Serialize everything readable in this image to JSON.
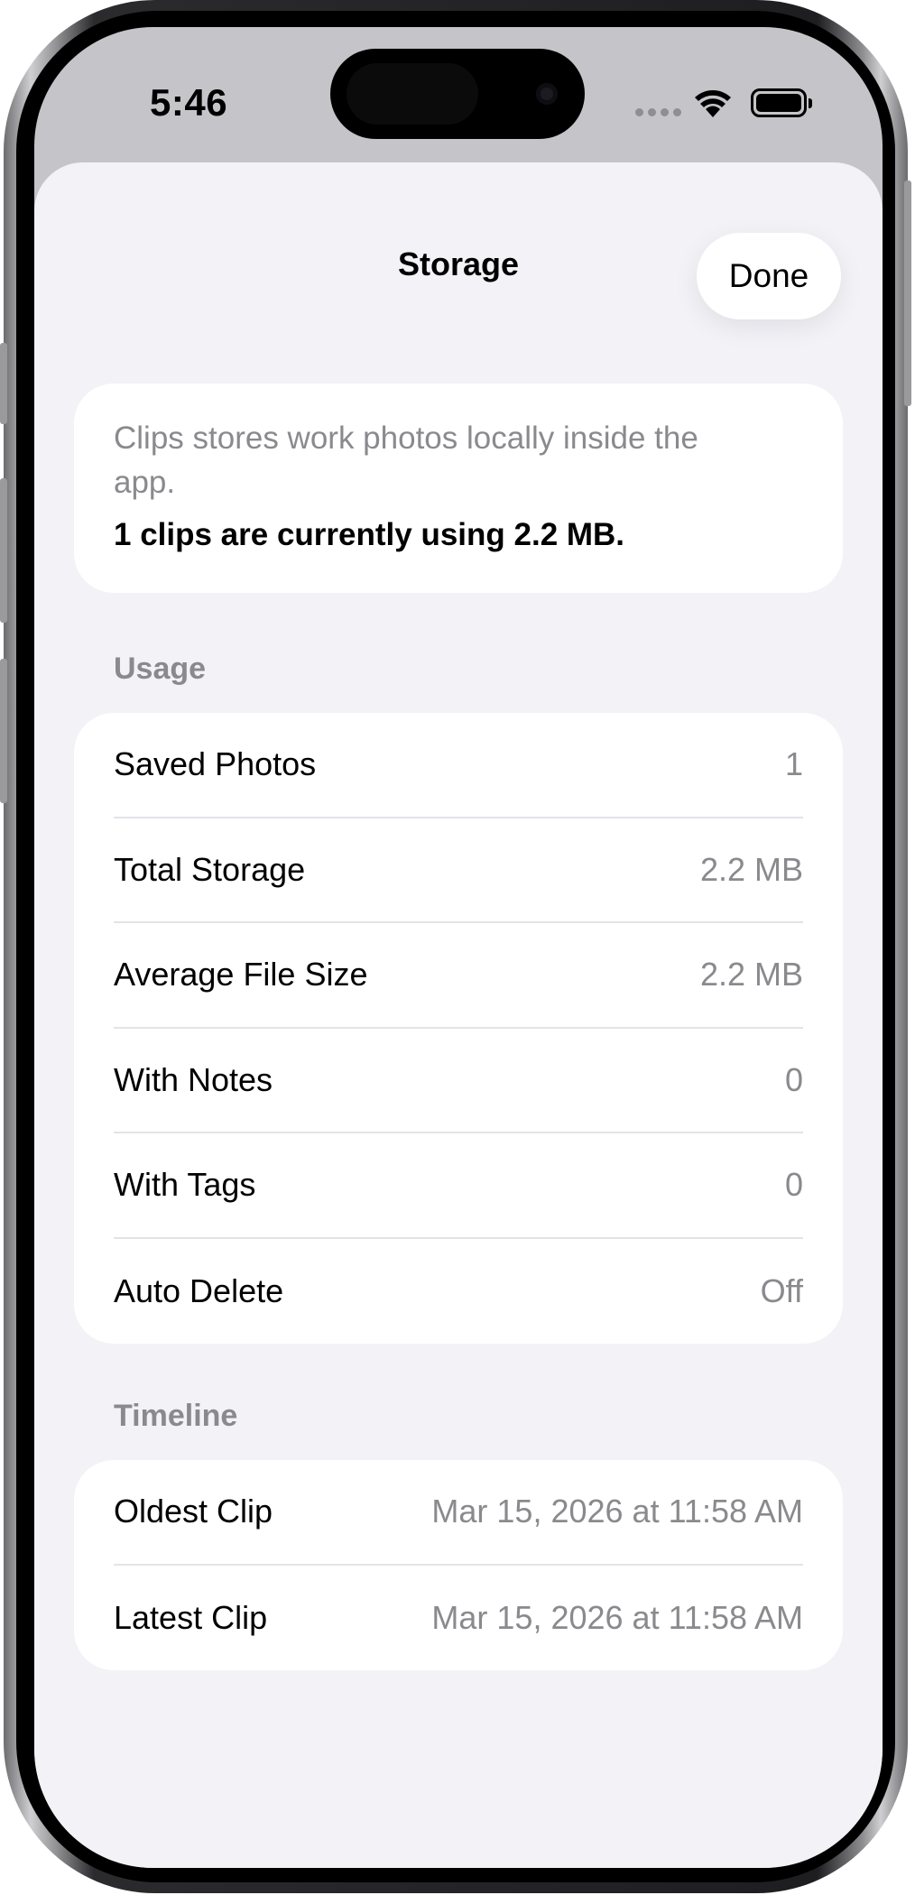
{
  "status_bar": {
    "time": "5:46"
  },
  "sheet": {
    "title": "Storage",
    "done_label": "Done"
  },
  "info": {
    "description": "Clips stores work photos locally inside the app.",
    "summary": "1 clips are currently using 2.2 MB."
  },
  "usage": {
    "header": "Usage",
    "rows": [
      {
        "label": "Saved Photos",
        "value": "1"
      },
      {
        "label": "Total Storage",
        "value": "2.2 MB"
      },
      {
        "label": "Average File Size",
        "value": "2.2 MB"
      },
      {
        "label": "With Notes",
        "value": "0"
      },
      {
        "label": "With Tags",
        "value": "0"
      },
      {
        "label": "Auto Delete",
        "value": "Off"
      }
    ]
  },
  "timeline": {
    "header": "Timeline",
    "rows": [
      {
        "label": "Oldest Clip",
        "value": "Mar 15, 2026 at 11:58 AM"
      },
      {
        "label": "Latest Clip",
        "value": "Mar 15, 2026 at 11:58 AM"
      }
    ]
  },
  "icons": {
    "wifi": "wifi-icon",
    "battery": "battery-icon",
    "signal": "cellular-signal-icon"
  },
  "colors": {
    "sheet_background": "#f2f2f7",
    "card_background": "#ffffff",
    "secondary_text": "#8a8a8e",
    "separator": "#e3e3e8"
  }
}
